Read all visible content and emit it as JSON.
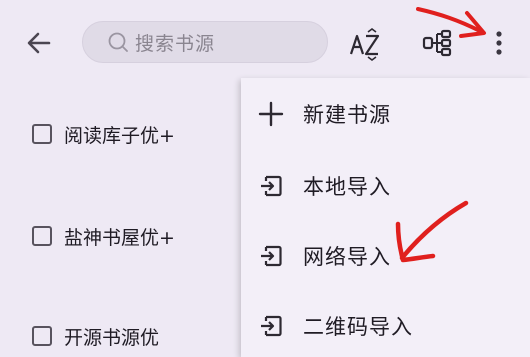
{
  "header": {
    "search_placeholder": "搜索书源"
  },
  "sources": [
    {
      "label": "阅读库子优+",
      "checked": false
    },
    {
      "label": "盐神书屋优+",
      "checked": false
    },
    {
      "label": "开源书源优",
      "checked": false
    }
  ],
  "menu": {
    "items": [
      {
        "label": "新建书源",
        "icon": "plus-icon"
      },
      {
        "label": "本地导入",
        "icon": "import-icon"
      },
      {
        "label": "网络导入",
        "icon": "import-icon"
      },
      {
        "label": "二维码导入",
        "icon": "import-icon"
      }
    ]
  },
  "colors": {
    "background": "#eee9f4",
    "menu_background": "#f3eff8",
    "annotation_red": "#e0201e"
  }
}
